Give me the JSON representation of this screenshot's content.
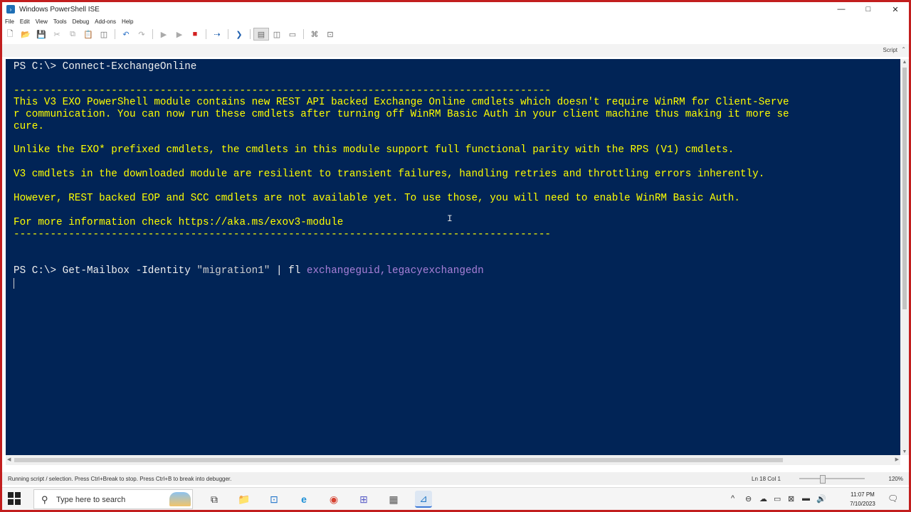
{
  "window": {
    "title": "Windows PowerShell ISE",
    "minimize_glyph": "—",
    "maximize_glyph": "□",
    "close_glyph": "✕"
  },
  "menu": [
    "File",
    "Edit",
    "View",
    "Tools",
    "Debug",
    "Add-ons",
    "Help"
  ],
  "toolbar": {
    "icons": [
      "new-icon",
      "open-icon",
      "save-icon",
      "cut-icon",
      "copy-icon",
      "paste-icon",
      "clear-icon",
      "undo-icon",
      "redo-icon",
      "run-icon",
      "run-selection-icon",
      "stop-icon",
      "new-remote-tab-icon",
      "powershell-icon",
      "layout-script-top-icon",
      "layout-script-right-icon",
      "layout-script-max-icon",
      "show-commands-icon",
      "addon-icon"
    ],
    "glyphs": {
      "new": "🗋",
      "open": "📂",
      "save": "💾",
      "cut": "✂",
      "copy": "⧉",
      "paste": "📋",
      "clear": "◫",
      "undo": "↶",
      "redo": "↷",
      "run": "▶",
      "run_selection": "▶",
      "stop": "■",
      "remote": "⇢",
      "ps": "❯",
      "layout1": "▤",
      "layout2": "◫",
      "layout3": "▭",
      "commands": "⌘",
      "addon": "⊡"
    },
    "colors": {
      "stop": "#d21f1f",
      "undo": "#2c72c7",
      "ps": "#1f5fae",
      "remote": "#1f5fae"
    }
  },
  "script_strip": {
    "label": "Script",
    "arrow": "⌃"
  },
  "console": {
    "background": "#012456",
    "lines": [
      "PS C:\\> Connect-ExchangeOnline",
      "----------------------------------------------------------------------------------------",
      "This V3 EXO PowerShell module contains new REST API backed Exchange Online cmdlets which doesn't require WinRM for Client-Serve",
      "r communication. You can now run these cmdlets after turning off WinRM Basic Auth in your client machine thus making it more se",
      "cure.",
      "Unlike the EXO* prefixed cmdlets, the cmdlets in this module support full functional parity with the RPS (V1) cmdlets.",
      "V3 cmdlets in the downloaded module are resilient to transient failures, handling retries and throttling errors inherently.",
      "However, REST backed EOP and SCC cmdlets are not available yet. To use those, you will need to enable WinRM Basic Auth.",
      "For more information check https://aka.ms/exov3-module",
      "----------------------------------------------------------------------------------------"
    ],
    "command2": {
      "prompt": "PS C:\\> ",
      "cmdlet": "Get-Mailbox ",
      "param": "-Identity ",
      "arg": "\"migration1\"",
      "pipe": " | ",
      "cmd": "fl ",
      "fields": "exchangeguid,legacyexchangedn"
    },
    "text_cursor": "I"
  },
  "scrollbars": {
    "up": "▲",
    "down": "▼",
    "left": "◀",
    "right": "▶"
  },
  "status": {
    "message": "Running script / selection.  Press Ctrl+Break to stop.  Press Ctrl+B to break into debugger.",
    "position": "Ln 18  Col 1",
    "zoom": "120%",
    "zoom_fraction": 0.35
  },
  "taskbar": {
    "search_placeholder": "Type here to search",
    "search_glyph": "⚲",
    "apps": {
      "taskview": "⧉",
      "explorer": "📁",
      "outlook": "⊡",
      "edge": "e",
      "chrome": "◉",
      "teams": "⊞",
      "calculator": "▦",
      "ps_ise": "⊿"
    },
    "tray": {
      "chevron": "^",
      "icons": [
        "⊖",
        "☁",
        "▭",
        "⊠",
        "▬",
        "🔊"
      ]
    },
    "time": "11:07 PM",
    "date": "7/10/2023",
    "notification": "🗨"
  }
}
